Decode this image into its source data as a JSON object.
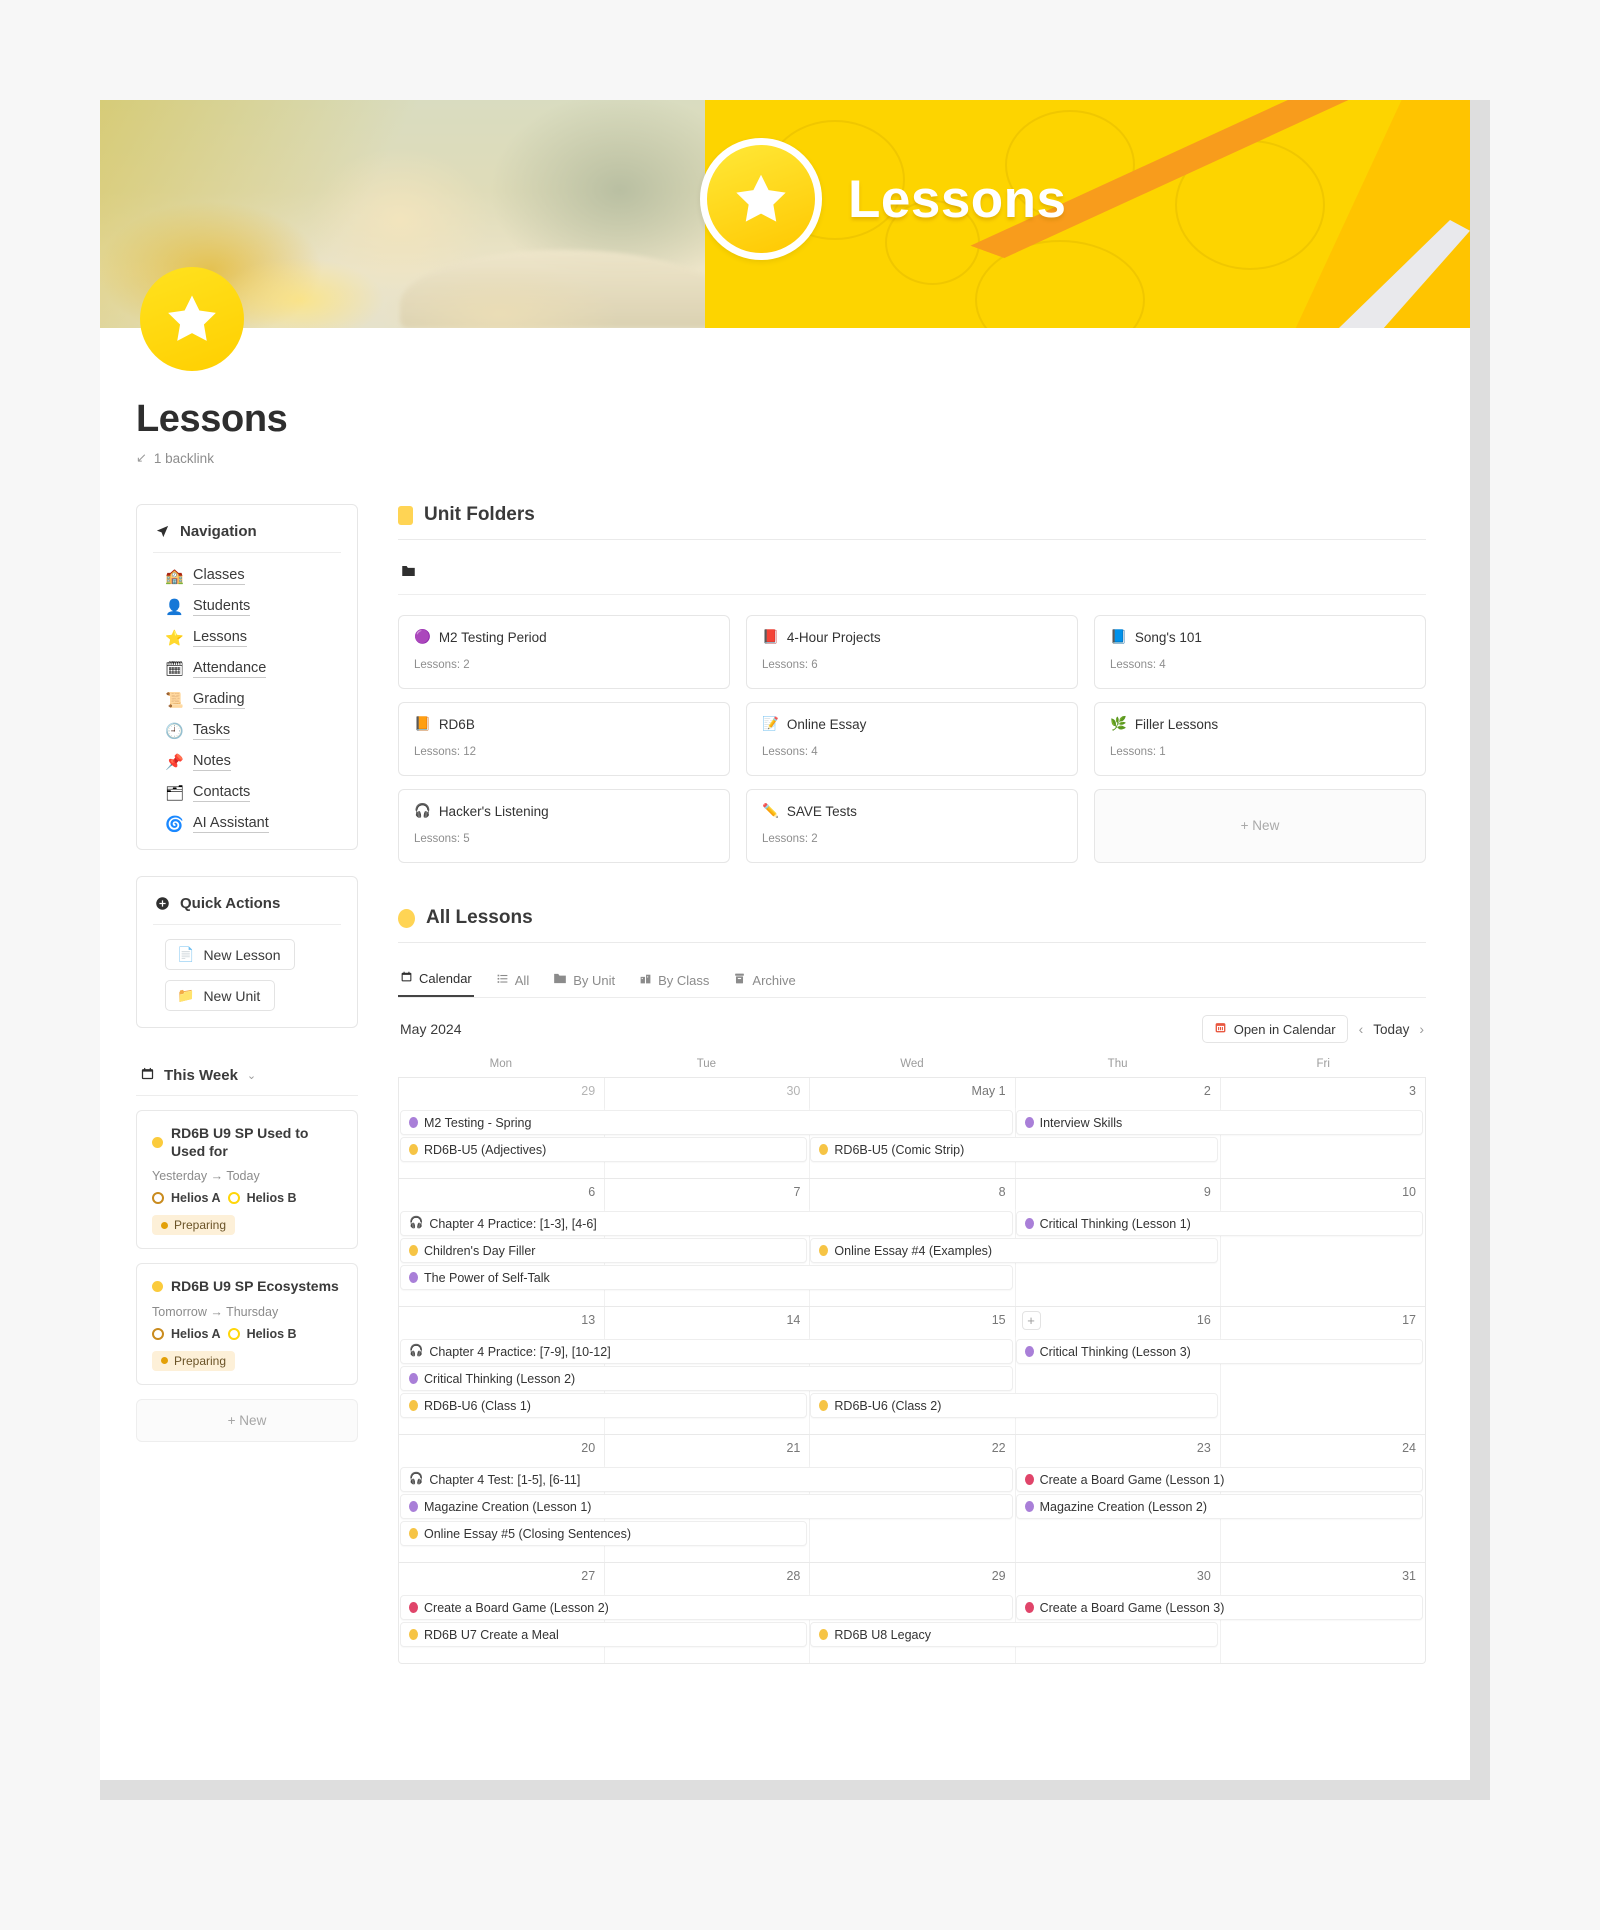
{
  "banner": {
    "title": "Lessons",
    "icon": "star-icon"
  },
  "page": {
    "title": "Lessons",
    "backlink": "1 backlink",
    "backlink_arrow": "↙"
  },
  "navigation": {
    "heading": "Navigation",
    "heading_icon": "navigation-arrow-icon",
    "items": [
      {
        "label": "Classes",
        "emoji": "🏫",
        "icon": "classes-icon"
      },
      {
        "label": "Students",
        "emoji": "👤",
        "icon": "students-icon"
      },
      {
        "label": "Lessons",
        "emoji": "⭐",
        "icon": "lessons-icon"
      },
      {
        "label": "Attendance",
        "emoji": "🗓",
        "icon": "attendance-icon"
      },
      {
        "label": "Grading",
        "emoji": "📜",
        "icon": "grading-icon"
      },
      {
        "label": "Tasks",
        "emoji": "🕘",
        "icon": "tasks-icon"
      },
      {
        "label": "Notes",
        "emoji": "📌",
        "icon": "notes-icon"
      },
      {
        "label": "Contacts",
        "emoji": "🗂",
        "icon": "contacts-icon"
      },
      {
        "label": "AI Assistant",
        "emoji": "🌀",
        "icon": "ai-assistant-icon"
      }
    ]
  },
  "quick_actions": {
    "heading": "Quick Actions",
    "heading_icon": "plus-circle-icon",
    "buttons": [
      {
        "label": "New Lesson",
        "emoji": "📄",
        "icon": "new-lesson-icon"
      },
      {
        "label": "New Unit",
        "emoji": "📁",
        "icon": "new-unit-icon"
      }
    ]
  },
  "this_week": {
    "heading": "This Week",
    "heading_icon": "calendar-icon",
    "chevron": "⌄",
    "new_label": "+  New",
    "cards": [
      {
        "title": "RD6B U9 SP Used to Used for",
        "dot_color": "#fbcb3c",
        "date": "Yesterday → Today",
        "classes": [
          "Helios A",
          "Helios B"
        ],
        "status": "Preparing"
      },
      {
        "title": "RD6B U9 SP Ecosystems",
        "dot_color": "#fbcb3c",
        "date": "Tomorrow → Thursday",
        "classes": [
          "Helios A",
          "Helios B"
        ],
        "status": "Preparing"
      }
    ]
  },
  "unit_folders": {
    "heading": "Unit Folders",
    "toolbar_icon": "folder-icon",
    "new_label": "+  New",
    "count_prefix": "Lessons: ",
    "items": [
      {
        "name": "M2 Testing Period",
        "emoji": "🟣",
        "lessons": "Lessons: 2"
      },
      {
        "name": "4-Hour Projects",
        "emoji": "📕",
        "lessons": "Lessons: 6"
      },
      {
        "name": "Song's 101",
        "emoji": "📘",
        "lessons": "Lessons: 4"
      },
      {
        "name": "RD6B",
        "emoji": "📙",
        "lessons": "Lessons: 12"
      },
      {
        "name": "Online Essay",
        "emoji": "📝",
        "lessons": "Lessons: 4"
      },
      {
        "name": "Filler Lessons",
        "emoji": "🌿",
        "lessons": "Lessons: 1"
      },
      {
        "name": "Hacker's Listening",
        "emoji": "🎧",
        "lessons": "Lessons: 5"
      },
      {
        "name": "SAVE Tests",
        "emoji": "✏️",
        "lessons": "Lessons: 2"
      }
    ]
  },
  "all_lessons": {
    "heading": "All Lessons",
    "tabs": [
      {
        "label": "Calendar",
        "emoji": "🗓",
        "icon": "calendar-icon",
        "active": true
      },
      {
        "label": "All",
        "emoji": "☰",
        "icon": "list-icon",
        "active": false
      },
      {
        "label": "By Unit",
        "emoji": "📁",
        "icon": "folder-icon",
        "active": false
      },
      {
        "label": "By Class",
        "emoji": "🏫",
        "icon": "school-icon",
        "active": false
      },
      {
        "label": "Archive",
        "emoji": "🗃",
        "icon": "archive-icon",
        "active": false
      }
    ],
    "toolbar": {
      "month": "May 2024",
      "open_in_calendar": "Open in Calendar",
      "open_icon": "calendar-red-icon",
      "prev": "‹",
      "today": "Today",
      "next": "›"
    },
    "calendar": {
      "dow": [
        "Mon",
        "Tue",
        "Wed",
        "Thu",
        "Fri"
      ],
      "weeks": [
        {
          "days": [
            {
              "num": "29",
              "muted": true
            },
            {
              "num": "30",
              "muted": true
            },
            {
              "num": "May 1",
              "muted": false
            },
            {
              "num": "2",
              "muted": false
            },
            {
              "num": "3",
              "muted": false
            }
          ],
          "events": [
            {
              "title": "M2 Testing - Spring",
              "start": 0,
              "span": 3,
              "dot": "#a97fd8",
              "glyph": ""
            },
            {
              "title": "Interview Skills",
              "start": 3,
              "span": 2,
              "dot": "#a97fd8",
              "glyph": ""
            },
            {
              "title": "RD6B-U5 (Adjectives)",
              "start": 0,
              "span": 2,
              "dot": "#f6c445",
              "glyph": ""
            },
            {
              "title": "RD6B-U5 (Comic Strip)",
              "start": 2,
              "span": 2,
              "dot": "#f6c445",
              "glyph": ""
            }
          ]
        },
        {
          "days": [
            {
              "num": "6",
              "muted": false
            },
            {
              "num": "7",
              "muted": false
            },
            {
              "num": "8",
              "muted": false
            },
            {
              "num": "9",
              "muted": false
            },
            {
              "num": "10",
              "muted": false
            }
          ],
          "events": [
            {
              "title": "Chapter 4 Practice: [1-3], [4-6]",
              "start": 0,
              "span": 3,
              "dot": "",
              "glyph": "🎧"
            },
            {
              "title": "Critical Thinking (Lesson 1)",
              "start": 3,
              "span": 2,
              "dot": "#a97fd8",
              "glyph": ""
            },
            {
              "title": "Children's Day Filler",
              "start": 0,
              "span": 2,
              "dot": "#f6c445",
              "glyph": ""
            },
            {
              "title": "Online Essay #4 (Examples)",
              "start": 2,
              "span": 2,
              "dot": "#f6c445",
              "glyph": ""
            },
            {
              "title": "The Power of Self-Talk",
              "start": 0,
              "span": 3,
              "dot": "#a97fd8",
              "glyph": ""
            }
          ]
        },
        {
          "days": [
            {
              "num": "13",
              "muted": false
            },
            {
              "num": "14",
              "muted": false
            },
            {
              "num": "15",
              "muted": false
            },
            {
              "num": "16",
              "muted": false,
              "plus": "+"
            },
            {
              "num": "17",
              "muted": false
            }
          ],
          "events": [
            {
              "title": "Chapter 4 Practice: [7-9], [10-12]",
              "start": 0,
              "span": 3,
              "dot": "",
              "glyph": "🎧"
            },
            {
              "title": "Critical Thinking (Lesson 3)",
              "start": 3,
              "span": 2,
              "dot": "#a97fd8",
              "glyph": ""
            },
            {
              "title": "Critical Thinking (Lesson 2)",
              "start": 0,
              "span": 3,
              "dot": "#a97fd8",
              "glyph": ""
            },
            {
              "title": "RD6B-U6 (Class 1)",
              "start": 0,
              "span": 2,
              "dot": "#f6c445",
              "glyph": ""
            },
            {
              "title": "RD6B-U6 (Class 2)",
              "start": 2,
              "span": 2,
              "dot": "#f6c445",
              "glyph": ""
            }
          ]
        },
        {
          "days": [
            {
              "num": "20",
              "muted": false
            },
            {
              "num": "21",
              "muted": false
            },
            {
              "num": "22",
              "muted": false
            },
            {
              "num": "23",
              "muted": false
            },
            {
              "num": "24",
              "muted": false
            }
          ],
          "events": [
            {
              "title": "Chapter 4 Test: [1-5], [6-11]",
              "start": 0,
              "span": 3,
              "dot": "",
              "glyph": "🎧"
            },
            {
              "title": "Create a Board Game (Lesson 1)",
              "start": 3,
              "span": 2,
              "dot": "#e0456a",
              "glyph": ""
            },
            {
              "title": "Magazine Creation (Lesson 1)",
              "start": 0,
              "span": 3,
              "dot": "#a97fd8",
              "glyph": ""
            },
            {
              "title": "Magazine Creation (Lesson 2)",
              "start": 3,
              "span": 2,
              "dot": "#a97fd8",
              "glyph": ""
            },
            {
              "title": "Online Essay #5 (Closing Sentences)",
              "start": 0,
              "span": 2,
              "dot": "#f6c445",
              "glyph": ""
            }
          ]
        },
        {
          "days": [
            {
              "num": "27",
              "muted": false
            },
            {
              "num": "28",
              "muted": false
            },
            {
              "num": "29",
              "muted": false
            },
            {
              "num": "30",
              "muted": false
            },
            {
              "num": "31",
              "muted": false
            }
          ],
          "events": [
            {
              "title": "Create a Board Game (Lesson 2)",
              "start": 0,
              "span": 3,
              "dot": "#e0456a",
              "glyph": ""
            },
            {
              "title": "Create a Board Game (Lesson 3)",
              "start": 3,
              "span": 2,
              "dot": "#e0456a",
              "glyph": ""
            },
            {
              "title": "RD6B U7 Create a Meal",
              "start": 0,
              "span": 2,
              "dot": "#f6c445",
              "glyph": ""
            },
            {
              "title": "RD6B U8 Legacy",
              "start": 2,
              "span": 2,
              "dot": "#f6c445",
              "glyph": ""
            }
          ]
        }
      ]
    }
  },
  "colors": {
    "brand_yellow": "#fdd400",
    "accent_orange": "#f89c1c",
    "purple_dot": "#a97fd8",
    "yellow_dot": "#f6c445",
    "red_dot": "#e0456a"
  }
}
